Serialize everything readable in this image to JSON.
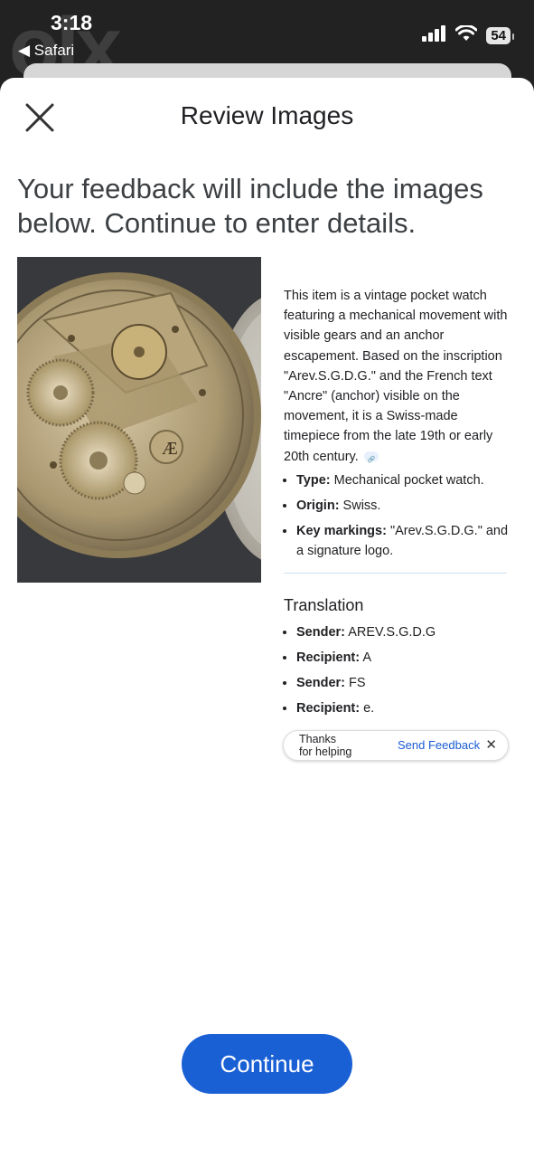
{
  "status_bar": {
    "time": "3:18",
    "back_app": "◀ Safari",
    "watermark": "olx",
    "battery": "54",
    "icons": [
      "cellular-signal-icon",
      "wifi-icon",
      "battery-icon"
    ]
  },
  "sheet": {
    "title": "Review Images",
    "close_icon": "close-icon"
  },
  "headline": "Your feedback will include the images below. Continue to enter details.",
  "image": {
    "subject": "vintage-pocket-watch-movement-photo"
  },
  "ai_panel": {
    "description": "This item is a vintage pocket watch featuring a mechanical movement with visible gears and an anchor escapement. Based on the inscription \"Arev.S.G.D.G.\" and the French text \"Ancre\" (anchor) visible on the movement, it is a Swiss-made timepiece from the late 19th or early 20th century.",
    "details": [
      {
        "label": "Type:",
        "value": " Mechanical pocket watch."
      },
      {
        "label": "Origin:",
        "value": " Swiss."
      },
      {
        "label": "Key markings:",
        "value": " \"Arev.S.G.D.G.\" and a signature logo."
      }
    ],
    "translation_title": "Translation",
    "translation": [
      {
        "label": "Sender:",
        "value": " AREV.S.G.D.G"
      },
      {
        "label": "Recipient:",
        "value": " A"
      },
      {
        "label": "Sender:",
        "value": " FS"
      },
      {
        "label": "Recipient:",
        "value": " e."
      }
    ]
  },
  "feedback_pill": {
    "thanks_line1": "Thanks",
    "thanks_line2": "for helping",
    "send_label": "Send Feedback",
    "close_glyph": "✕"
  },
  "footer": {
    "continue_label": "Continue"
  },
  "colors": {
    "primary": "#1a60d5",
    "link": "#1a5bd3",
    "status_bg": "#222222"
  }
}
